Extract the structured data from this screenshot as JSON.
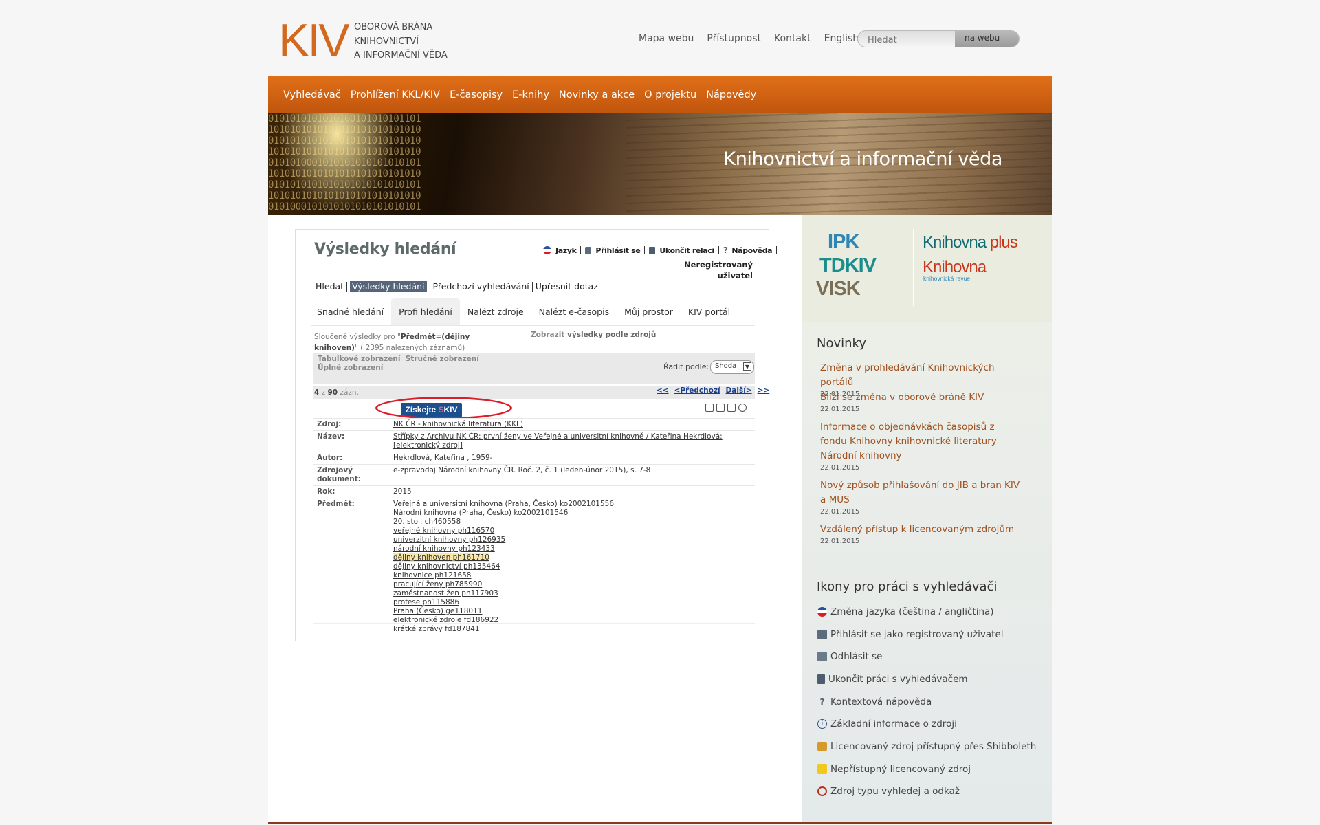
{
  "header": {
    "logo_mark": "KIV",
    "logo_lines": [
      "Oborová brána",
      "knihovnictví",
      "a informační věda"
    ],
    "links": [
      "Mapa webu",
      "Přístupnost",
      "Kontakt",
      "English"
    ],
    "search_placeholder": "Hledat",
    "search_button": "na webu"
  },
  "nav": [
    "Vyhledávač",
    "Prohlížení KKL/KIV",
    "E-časopisy",
    "E-knihy",
    "Novinky a akce",
    "O projektu",
    "Nápovědy"
  ],
  "banner": {
    "title": "Knihovnictví a informační věda",
    "code_text": "0101010101010100101010101101\n1010101010101010101010101010\n0101010101010010101010101010\n1010101010101010101010101010\n0101010001010101010101010101\n1010101010101010101010101010\n0101010101010101010101010101\n1010101010101010101010101010\n0101000101010101010101010101"
  },
  "right": {
    "partners": {
      "ipk": "IPK",
      "tdkiv": "TDKIV",
      "visk": "VISK",
      "kplus_a": "Knihovna",
      "kplus_b": "plus",
      "krevue": "Knihovna",
      "krevue_sub": "knihovnická revue"
    },
    "novinky_title": "Novinky",
    "news": [
      {
        "title": "Změna v prohledávání Knihovnických portálů",
        "date": "22.01.2015"
      },
      {
        "title": "Blíží se změna v oborové bráně KIV",
        "date": "22.01.2015"
      },
      {
        "title": "Informace o objednávkách časopisů z fondu Knihovny knihovnické literatury Národní knihovny",
        "date": "22.01.2015"
      },
      {
        "title": "Nový způsob přihlašování do JIB a bran KIV a MUS",
        "date": "22.01.2015"
      },
      {
        "title": "Vzdálený přístup k licencovaným zdrojům",
        "date": "22.01.2015"
      }
    ],
    "icons_title": "Ikony pro práci s vyhledávači",
    "icons": [
      {
        "label": "Změna jazyka (čeština / angličtina)",
        "icon": "flag-icon"
      },
      {
        "label": "Přihlásit se jako registrovaný uživatel",
        "icon": "lock-icon"
      },
      {
        "label": "Odhlásit se",
        "icon": "unlock-icon"
      },
      {
        "label": "Ukončit práci s vyhledávačem",
        "icon": "door-icon"
      },
      {
        "label": "Kontextová nápověda",
        "icon": "question-icon"
      },
      {
        "label": "Základní informace o zdroji",
        "icon": "info-icon"
      },
      {
        "label": "Licencovaný zdroj přístupný přes Shibboleth",
        "icon": "shibboleth-icon"
      },
      {
        "label": "Nepřístupný licencovaný zdroj",
        "icon": "padlock-icon"
      },
      {
        "label": "Zdroj typu vyhledej a odkaž",
        "icon": "forbidden-icon"
      }
    ]
  },
  "panel": {
    "title": "Výsledky hledání",
    "session": [
      "Jazyk",
      "Přihlásit se",
      "Ukončit relaci",
      "Nápověda"
    ],
    "unreg": [
      "Neregistrovaný",
      "uživatel"
    ],
    "subnav": [
      "Hledat",
      "Výsledky hledání",
      "Předchozí vyhledávání",
      "Upřesnit dotaz"
    ],
    "tabs": [
      "Snadné hledání",
      "Profi hledání",
      "Nalézt zdroje",
      "Nalézt e-časopis",
      "Můj prostor",
      "KIV portál"
    ],
    "merged_pre": "Sloučené výsledky pro \"",
    "merged_query": "Předmět=(dějiny knihoven)",
    "merged_post": "\" ( 2395 nalezených záznamů)",
    "show_label": "Zobrazit",
    "show_link": "výsledky podle zdrojů",
    "view_table": "Tabulkové zobrazení",
    "view_brief": "Stručné zobrazení",
    "view_full": "Úplné zobrazení",
    "sort_label": "Řadit podle:",
    "sort_value": "Shoda",
    "count_num": "4",
    "count_of": " z ",
    "count_total": "90",
    "count_unit": " zázn.",
    "pager": [
      "<<",
      "<Předchozí",
      "Další>",
      ">>"
    ],
    "get_btn_a": "Získejte",
    "get_btn_s": "S",
    "get_btn_b": "KIV",
    "record": {
      "zdroj_k": "Zdroj:",
      "zdroj_v": "NK ČR - knihovnická literatura (KKL)",
      "nazev_k": "Název:",
      "nazev_v": "Střípky z Archivu NK ČR: první ženy ve Veřejné a universitní knihovně / Kateřina Hekrdlová: [elektronický zdroj]",
      "autor_k": "Autor:",
      "autor_v": "Hekrdlová, Kateřina , 1959-",
      "zdrdok_k": "Zdrojový dokument:",
      "zdrdok_v": "e-zpravodaj Národní knihovny ČR. Roč. 2, č. 1 (leden-únor 2015), s. 7-8",
      "rok_k": "Rok:",
      "rok_v": "2015",
      "predmet_k": "Předmět:",
      "predmet": [
        "Veřejná a universitní knihovna (Praha, Česko) ko2002101556",
        "Národní knihovna (Praha, Česko) ko2002101546",
        "20. stol. ch460558",
        "veřejné knihovny ph116570",
        "univerzitní knihovny ph126935",
        "národní knihovny ph123433",
        "dějiny knihoven ph161710",
        "dějiny knihovnictví ph135464",
        "knihovnice ph121658",
        "pracující ženy ph785990",
        "zaměstnanost žen ph117903",
        "profese ph115886",
        "Praha (Česko) ge118011",
        "elektronické zdroje fd186922",
        "krátké zprávy fd187841"
      ]
    }
  },
  "colors": {
    "accent": "#d2691e",
    "nav": "#d2651a",
    "news_link": "#a0501e",
    "button": "#1c4f8e",
    "highlight_oval": "#dd1d2a"
  }
}
